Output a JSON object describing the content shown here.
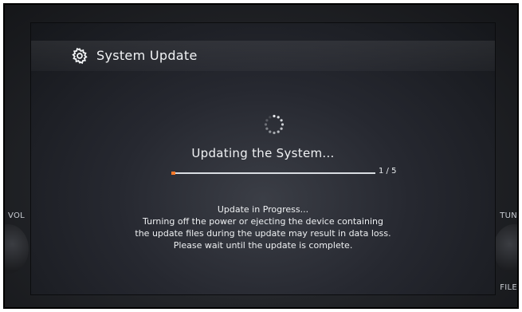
{
  "device": {
    "left_label": "VOL",
    "right_top_label": "TUN",
    "right_bottom_label": "FILE"
  },
  "header": {
    "icon": "gear-icon",
    "title": "System Update"
  },
  "status": {
    "spinner_icon": "loading-spinner-icon",
    "heading": "Updating the System...",
    "progress_fraction": 0.02,
    "progress_current": "1",
    "progress_total": "5",
    "progress_text": "1 / 5",
    "accent_color": "#ff7a2a"
  },
  "message": {
    "lines": [
      "Update in Progress...",
      "Turning off the power or ejecting the device containing",
      "the update files during the update may result in data loss.",
      "Please wait until the update is complete."
    ]
  }
}
